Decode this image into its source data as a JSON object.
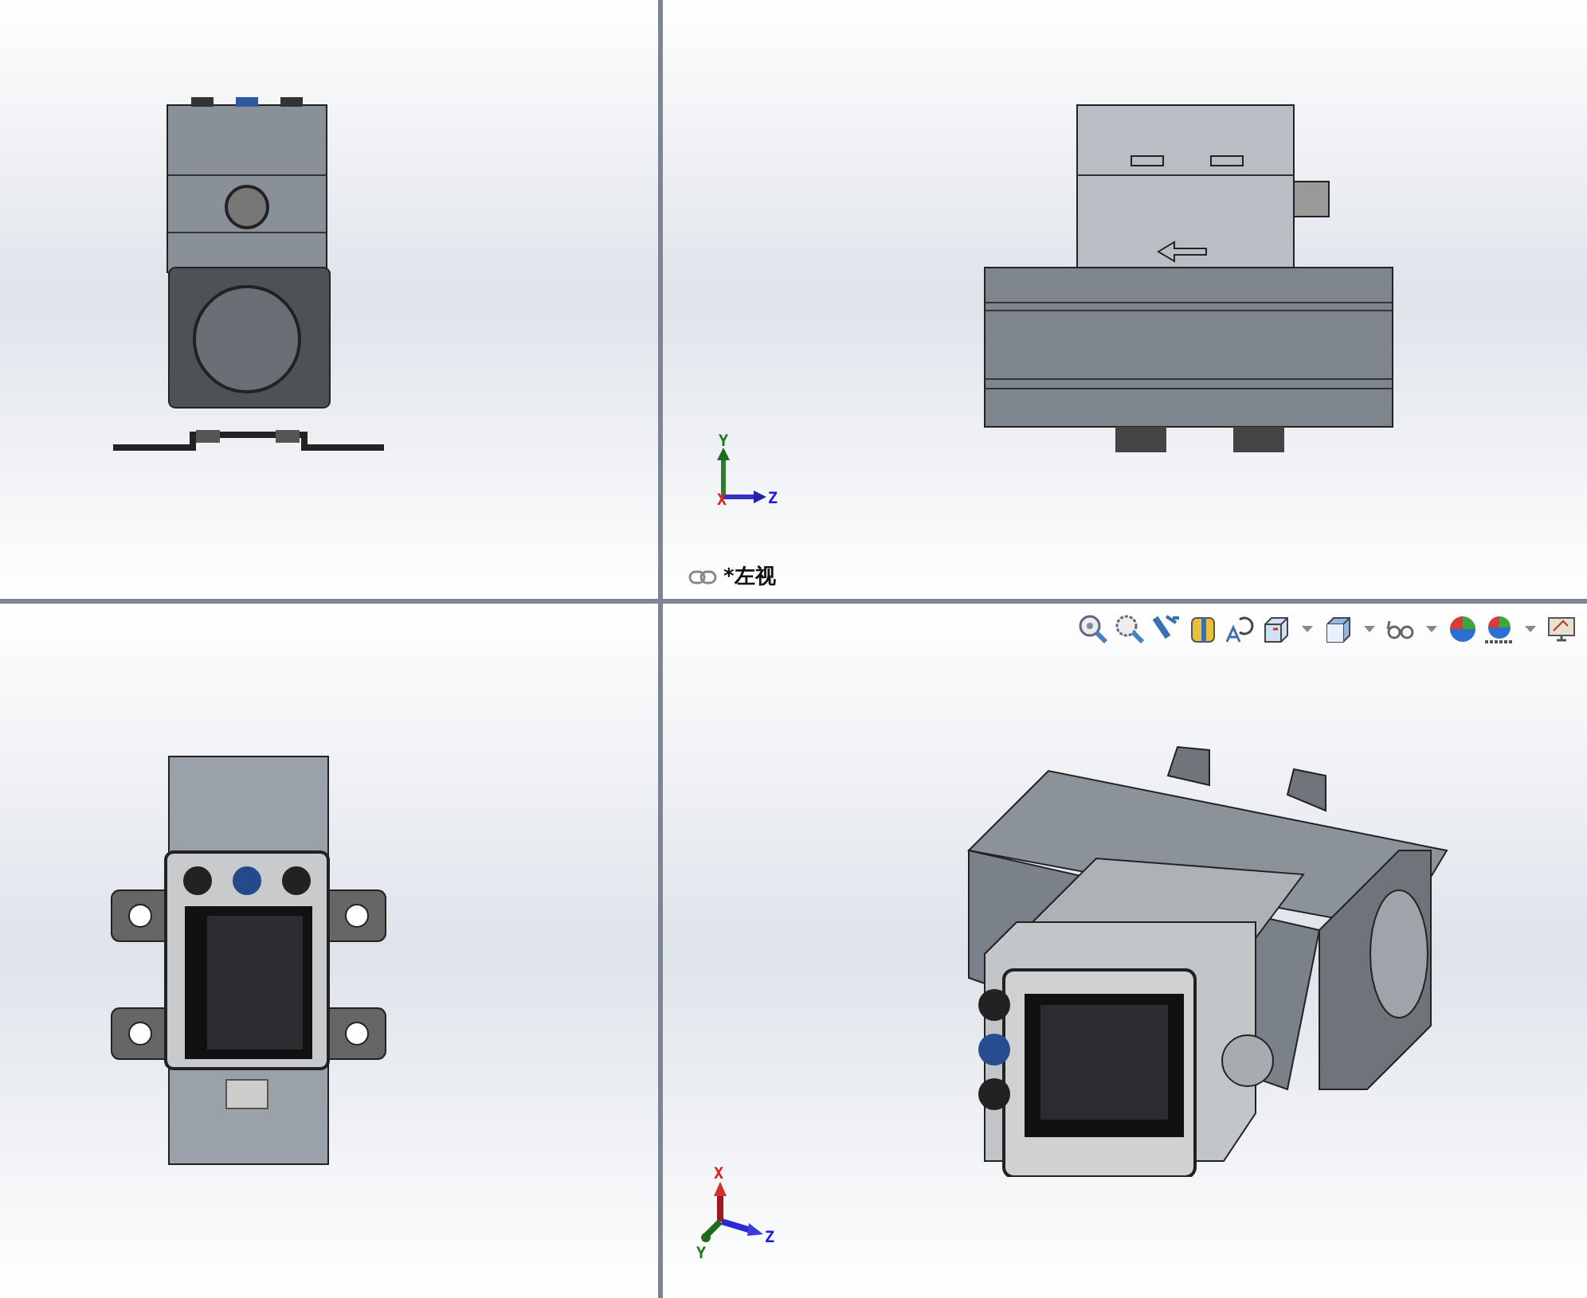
{
  "viewports": [
    {
      "kind": "front"
    },
    {
      "kind": "top",
      "triad": {
        "kind": "planar",
        "axes": [
          "X",
          "Y",
          "Z"
        ]
      },
      "label": "*左视"
    },
    {
      "kind": "right"
    },
    {
      "kind": "isometric",
      "triad": {
        "kind": "isometric",
        "axes": [
          "X",
          "Y",
          "Z"
        ]
      },
      "toolbar": [
        {
          "kind": "zoom-fit"
        },
        {
          "kind": "zoom-area"
        },
        {
          "kind": "previous-view"
        },
        {
          "kind": "section-view"
        },
        {
          "kind": "dynamic-annotation"
        },
        {
          "kind": "view-orientation"
        },
        {
          "kind": "caret"
        },
        {
          "kind": "display-style"
        },
        {
          "kind": "caret"
        },
        {
          "kind": "hide-show"
        },
        {
          "kind": "caret"
        },
        {
          "kind": "appearance"
        },
        {
          "kind": "scene"
        },
        {
          "kind": "caret"
        },
        {
          "kind": "view-settings"
        }
      ]
    }
  ]
}
